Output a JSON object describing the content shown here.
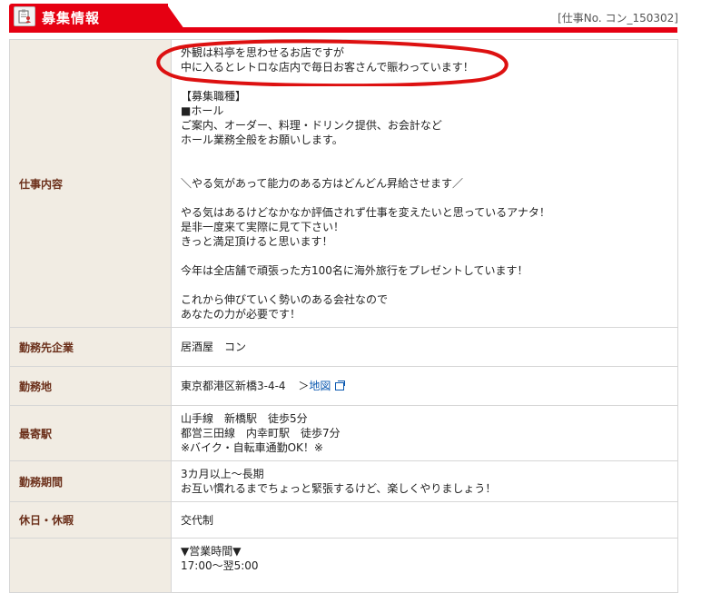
{
  "header": {
    "title": "募集情報",
    "job_no": "[仕事No. コン_150302]",
    "icon": "clipboard-person-icon"
  },
  "rows": [
    {
      "label": "仕事内容",
      "lines": [
        "外観は料亭を思わせるお店ですが",
        "中に入るとレトロな店内で毎日お客さんで賑わっています！",
        "",
        "【募集職種】",
        "■ホール",
        "ご案内、オーダー、料理・ドリンク提供、お会計など",
        "ホール業務全般をお願いします。",
        "",
        "",
        "＼やる気があって能力のある方はどんどん昇給させます／",
        "",
        "やる気はあるけどなかなか評価されず仕事を変えたいと思っているアナタ！",
        "是非一度来て実際に見て下さい！",
        "きっと満足頂けると思います！",
        "",
        "今年は全店舗で頑張った方100名に海外旅行をプレゼントしています！",
        "",
        "これから伸びていく勢いのある会社なので",
        "あなたの力が必要です！"
      ]
    },
    {
      "label": "勤務先企業",
      "lines": [
        "居酒屋　コン"
      ]
    },
    {
      "label": "勤務地",
      "address": "東京都港区新橋3-4-4",
      "map_prefix": "＞",
      "map_label": "地図"
    },
    {
      "label": "最寄駅",
      "lines": [
        "山手線　新橋駅　徒歩5分",
        "都営三田線　内幸町駅　徒歩7分",
        "※バイク・自転車通勤OK！※"
      ]
    },
    {
      "label": "勤務期間",
      "lines": [
        "3カ月以上～長期",
        "お互い慣れるまでちょっと緊張するけど、楽しくやりましょう！"
      ]
    },
    {
      "label": "休日・休暇",
      "lines": [
        "交代制"
      ]
    },
    {
      "label": "",
      "lines": [
        "▼営業時間▼",
        "17:00～翌5:00"
      ]
    }
  ],
  "annotation_color": "#dd1111"
}
